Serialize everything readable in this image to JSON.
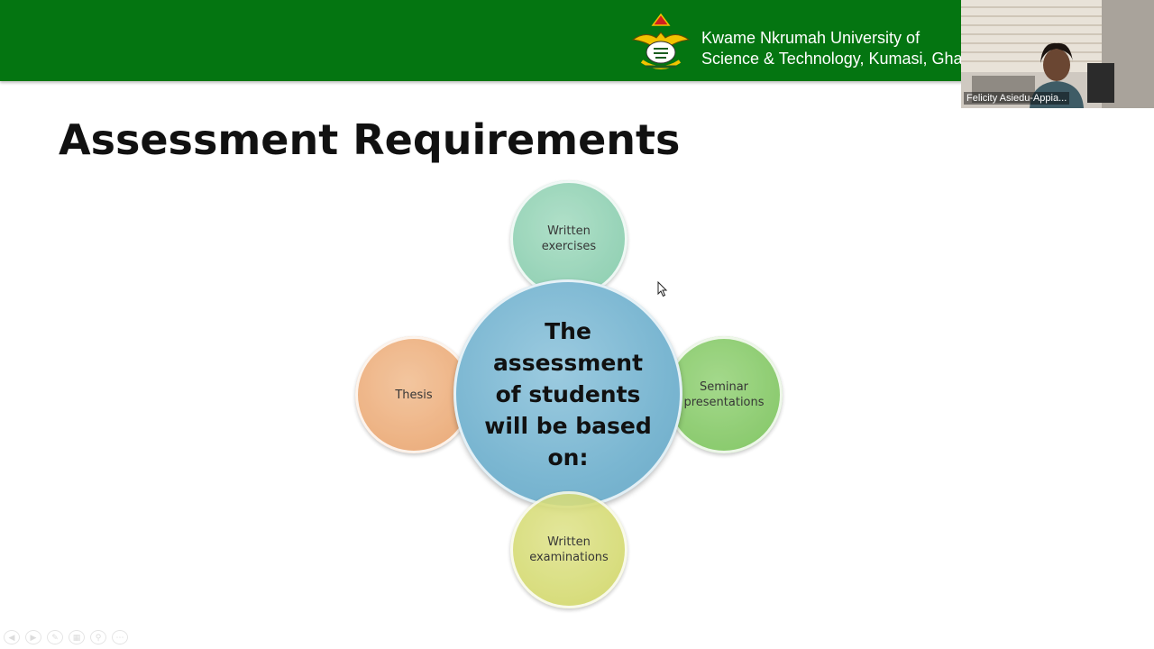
{
  "header": {
    "university_line1": "Kwame Nkrumah University of",
    "university_line2": "Science & Technology, Kumasi, Ghana",
    "brand_color": "#047511"
  },
  "video": {
    "participant_name": "Felicity Asiedu-Appia..."
  },
  "slide": {
    "title": "Assessment Requirements",
    "center_text": "The assessment of students will be based on:",
    "items": {
      "top": "Written exercises",
      "right": "Seminar presentations",
      "bottom": "Written examinations",
      "left": "Thesis"
    },
    "colors": {
      "center": "#7ab6d1",
      "top": "#86ccac",
      "right": "#7cc45c",
      "bottom": "#d2d86a",
      "left": "#eaa670"
    }
  },
  "toolbar": {
    "icons": [
      "previous-icon",
      "next-icon",
      "pen-icon",
      "slides-icon",
      "zoom-icon",
      "more-icon"
    ]
  }
}
